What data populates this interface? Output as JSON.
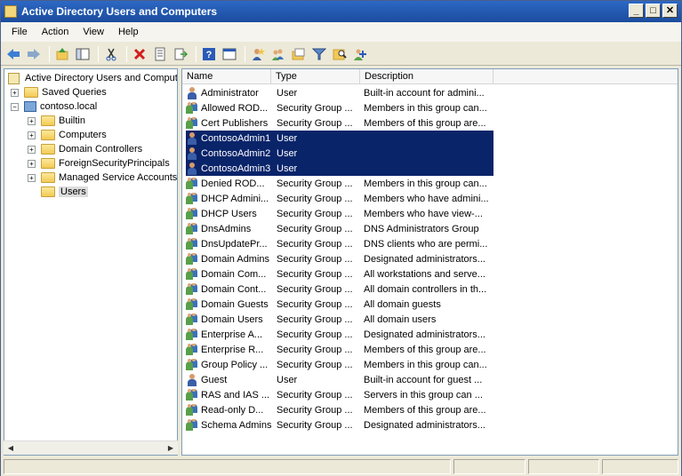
{
  "window": {
    "title": "Active Directory Users and Computers",
    "buttons": [
      "_",
      "□",
      "✕"
    ]
  },
  "menu": [
    "File",
    "Action",
    "View",
    "Help"
  ],
  "tree": {
    "root": "Active Directory Users and Comput",
    "saved_queries": "Saved Queries",
    "domain": "contoso.local",
    "children": [
      "Builtin",
      "Computers",
      "Domain Controllers",
      "ForeignSecurityPrincipals",
      "Managed Service Accounts",
      "Users"
    ],
    "selected": "Users"
  },
  "columns": [
    "Name",
    "Type",
    "Description"
  ],
  "rows": [
    {
      "name": "Administrator",
      "type": "User",
      "desc": "Built-in account for admini...",
      "icon": "user-icon"
    },
    {
      "name": "Allowed ROD...",
      "type": "Security Group ...",
      "desc": "Members in this group can...",
      "icon": "group-icon"
    },
    {
      "name": "Cert Publishers",
      "type": "Security Group ...",
      "desc": "Members of this group are...",
      "icon": "group-icon"
    },
    {
      "name": "ContosoAdmin1",
      "type": "User",
      "desc": "",
      "icon": "user-icon",
      "selected": true
    },
    {
      "name": "ContosoAdmin2",
      "type": "User",
      "desc": "",
      "icon": "user-icon",
      "selected": true
    },
    {
      "name": "ContosoAdmin3",
      "type": "User",
      "desc": "",
      "icon": "user-icon",
      "selected": true
    },
    {
      "name": "Denied ROD...",
      "type": "Security Group ...",
      "desc": "Members in this group can...",
      "icon": "group-icon"
    },
    {
      "name": "DHCP Admini...",
      "type": "Security Group ...",
      "desc": "Members who have admini...",
      "icon": "group-icon"
    },
    {
      "name": "DHCP Users",
      "type": "Security Group ...",
      "desc": "Members who have view-...",
      "icon": "group-icon"
    },
    {
      "name": "DnsAdmins",
      "type": "Security Group ...",
      "desc": "DNS Administrators Group",
      "icon": "group-icon"
    },
    {
      "name": "DnsUpdatePr...",
      "type": "Security Group ...",
      "desc": "DNS clients who are permi...",
      "icon": "group-icon"
    },
    {
      "name": "Domain Admins",
      "type": "Security Group ...",
      "desc": "Designated administrators...",
      "icon": "group-icon"
    },
    {
      "name": "Domain Com...",
      "type": "Security Group ...",
      "desc": "All workstations and serve...",
      "icon": "group-icon"
    },
    {
      "name": "Domain Cont...",
      "type": "Security Group ...",
      "desc": "All domain controllers in th...",
      "icon": "group-icon"
    },
    {
      "name": "Domain Guests",
      "type": "Security Group ...",
      "desc": "All domain guests",
      "icon": "group-icon"
    },
    {
      "name": "Domain Users",
      "type": "Security Group ...",
      "desc": "All domain users",
      "icon": "group-icon"
    },
    {
      "name": "Enterprise A...",
      "type": "Security Group ...",
      "desc": "Designated administrators...",
      "icon": "group-icon"
    },
    {
      "name": "Enterprise R...",
      "type": "Security Group ...",
      "desc": "Members of this group are...",
      "icon": "group-icon"
    },
    {
      "name": "Group Policy ...",
      "type": "Security Group ...",
      "desc": "Members in this group can...",
      "icon": "group-icon"
    },
    {
      "name": "Guest",
      "type": "User",
      "desc": "Built-in account for guest ...",
      "icon": "user-icon"
    },
    {
      "name": "RAS and IAS ...",
      "type": "Security Group ...",
      "desc": "Servers in this group can ...",
      "icon": "group-icon"
    },
    {
      "name": "Read-only D...",
      "type": "Security Group ...",
      "desc": "Members of this group are...",
      "icon": "group-icon"
    },
    {
      "name": "Schema Admins",
      "type": "Security Group ...",
      "desc": "Designated administrators...",
      "icon": "group-icon"
    }
  ],
  "toolbar_icons": [
    "back-icon",
    "forward-icon",
    "up-icon",
    "show-tree-icon",
    "cut-icon",
    "delete-icon",
    "properties-icon",
    "export-icon",
    "help-icon",
    "show-hide-icon",
    "new-user-icon",
    "new-group-icon",
    "new-ou-icon",
    "filter-icon",
    "find-icon",
    "add-to-group-icon"
  ],
  "colors": {
    "selection": "#0a246a",
    "titlebar": "#2d68c4"
  }
}
